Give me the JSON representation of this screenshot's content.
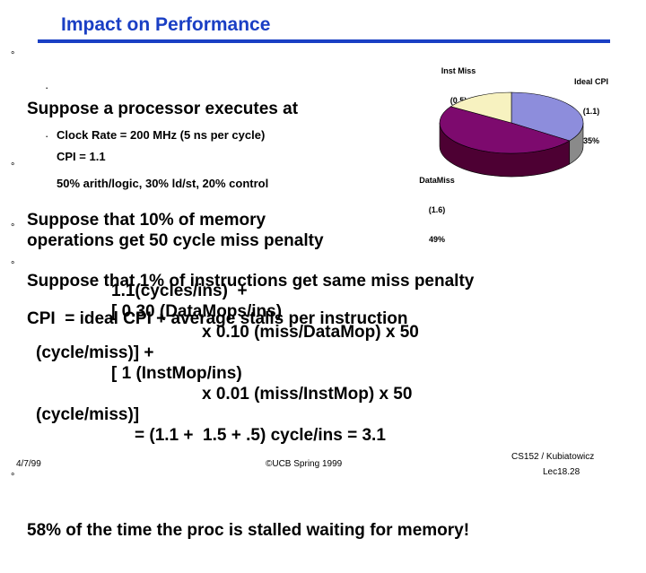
{
  "slide": {
    "title": "Impact on Performance",
    "title_color": "#1a3fc4",
    "bullet_mark": "°",
    "subbullet_mark": "·",
    "bullets": [
      {
        "text": "Suppose a processor executes at"
      },
      {
        "text": "Suppose that 10% of memory\noperations get 50 cycle miss penalty"
      },
      {
        "text": "Suppose that 1% of instructions get same miss penalty"
      },
      {
        "text": "CPI  = ideal CPI + average stalls per instruction"
      },
      {
        "text": "58% of the time the proc is stalled waiting for memory!"
      }
    ],
    "subbullets": [
      {
        "text": "Clock Rate = 200 MHz (5 ns per cycle)"
      },
      {
        "text": "CPI = 1.1"
      },
      {
        "text": "50% arith/logic, 30% ld/st, 20% control"
      }
    ],
    "formula_lines": [
      "1.1(cycles/ins)  +",
      "[ 0.30 (DataMops/ins)",
      "x 0.10 (miss/DataMop) x 50",
      "(cycle/miss)] +",
      "[ 1 (InstMop/ins)",
      "x 0.01 (miss/InstMop) x 50",
      "(cycle/miss)]",
      "= (1.1 +  1.5 + .5) cycle/ins = 3.1"
    ]
  },
  "chart_data": {
    "type": "pie",
    "title": "",
    "categories": [
      "Ideal CPI",
      "DataMiss",
      "Inst Miss"
    ],
    "values": [
      35,
      49,
      16
    ],
    "value_unit": "%",
    "data_labels": [
      "(1.1)",
      "(1.6)",
      "(0.5)"
    ],
    "colors": [
      "#8d8ddc",
      "#7d0a6e",
      "#f7f2c0"
    ],
    "side_colors": [
      "#8a8a8a",
      "#4d0033",
      "#cfc9a0"
    ],
    "legend_position": "outside-callout",
    "labels": [
      {
        "name": "Inst Miss",
        "value_text": "(0.5)",
        "pct_text": "16%"
      },
      {
        "name": "Ideal CPI",
        "value_text": "(1.1)",
        "pct_text": "35%"
      },
      {
        "name": "DataMiss",
        "value_text": "(1.6)",
        "pct_text": "49%"
      }
    ],
    "three_d": true
  },
  "footer": {
    "date": "4/7/99",
    "center": "©UCB Spring 1999",
    "course": "CS152 / Kubiatowicz",
    "lecture": "Lec18.28"
  }
}
